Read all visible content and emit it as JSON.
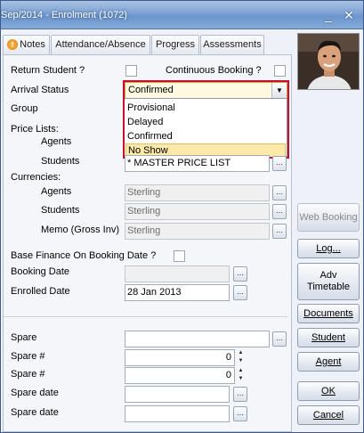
{
  "window": {
    "title": "Sep/2014 - Enrolment (1072)",
    "minimize_label": "_",
    "close_label": "✕"
  },
  "tabs": [
    {
      "label": "Notes",
      "icon": "info-icon"
    },
    {
      "label": "Attendance/Absence"
    },
    {
      "label": "Progress"
    },
    {
      "label": "Assessments"
    }
  ],
  "form": {
    "return_student_label": "Return Student ?",
    "continuous_booking_label": "Continuous Booking ?",
    "arrival_status_label": "Arrival Status",
    "arrival_status_value": "Confirmed",
    "arrival_status_options": [
      "Provisional",
      "Delayed",
      "Confirmed",
      "No Show"
    ],
    "arrival_status_highlighted": "No Show",
    "group_label": "Group",
    "price_lists_label": "Price Lists:",
    "agents_label": "Agents",
    "students_label": "Students",
    "students_price_value": "* MASTER PRICE LIST",
    "currencies_label": "Currencies:",
    "currency_agents_label": "Agents",
    "currency_agents_value": "Sterling",
    "currency_students_label": "Students",
    "currency_students_value": "Sterling",
    "memo_label": "Memo (Gross Inv)",
    "memo_value": "Sterling",
    "base_finance_label": "Base Finance On Booking Date ?",
    "booking_date_label": "Booking Date",
    "booking_date_value": "",
    "enrolled_date_label": "Enrolled Date",
    "enrolled_date_value": "28 Jan 2013",
    "spare_label": "Spare",
    "spare_value": "",
    "spare_num1_label": "Spare #",
    "spare_num1_value": "0",
    "spare_num2_label": "Spare #",
    "spare_num2_value": "0",
    "spare_date1_label": "Spare date",
    "spare_date2_label": "Spare date",
    "ellipsis": "...",
    "spin_up": "▲",
    "spin_down": "▼"
  },
  "sidebar": {
    "web_booking": "Web Booking",
    "log": "Log...",
    "adv_timetable_line1": "Adv",
    "adv_timetable_line2": "Timetable",
    "documents": "Documents",
    "student": "Student",
    "agent": "Agent",
    "ok": "OK",
    "cancel": "Cancel"
  },
  "colors": {
    "titlebar": "#7ea3d4",
    "highlight_border": "#c8102e",
    "dropdown_highlight": "#fde9a8"
  }
}
